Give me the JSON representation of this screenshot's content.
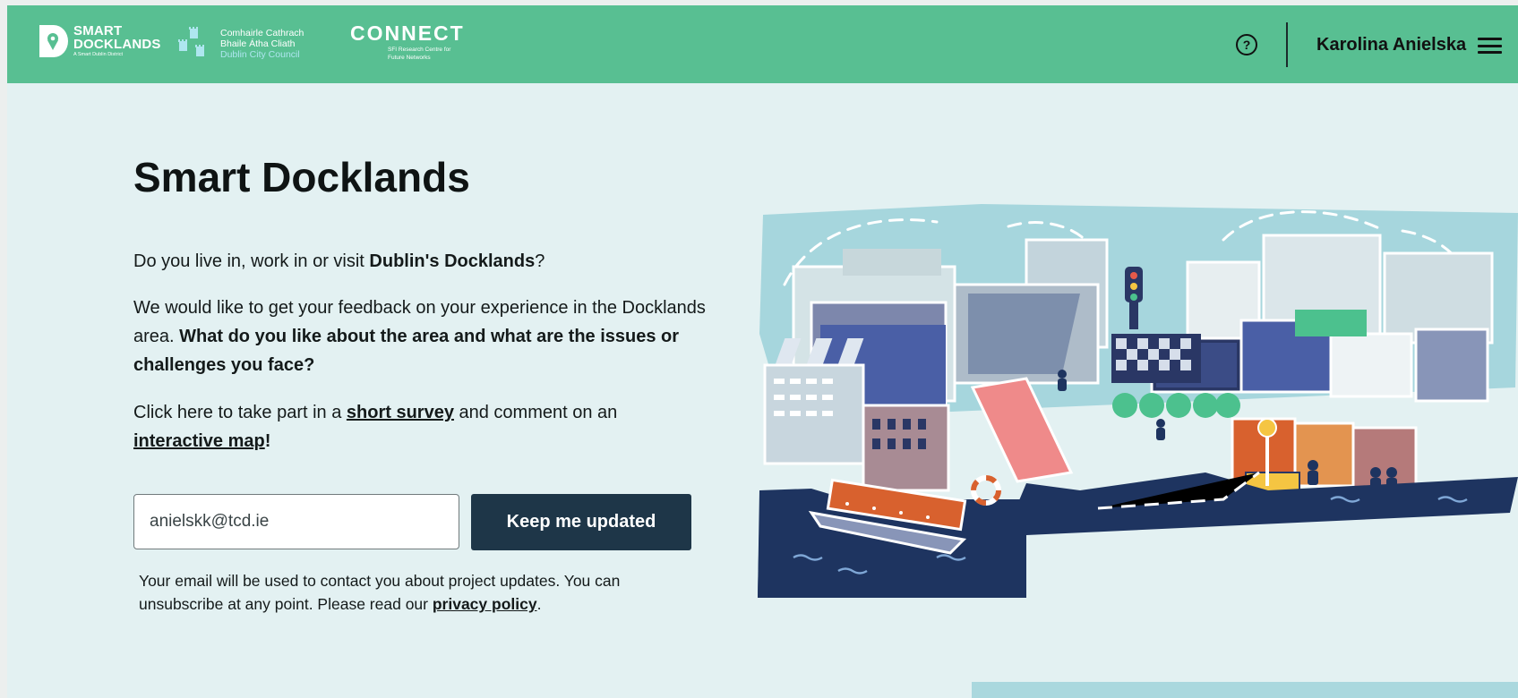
{
  "header": {
    "logo_sd": {
      "line1": "SMART",
      "line2": "DOCKLANDS",
      "tagline": "A Smart Dublin District"
    },
    "logo_dcc": {
      "line1": "Comhairle Cathrach",
      "line2": "Bhaile Átha Cliath",
      "line3": "Dublin City Council"
    },
    "logo_connect": {
      "word": "CONNECT",
      "sub1": "SFI Research Centre for",
      "sub2": "Future Networks"
    },
    "help_icon": "?",
    "user_name": "Karolina Anielska"
  },
  "main": {
    "title": "Smart Docklands",
    "p1": {
      "before": "Do you live in, work in or visit ",
      "bold": "Dublin's Docklands",
      "after": "?"
    },
    "p2": {
      "before": "We would like to get your feedback on your experience in the Docklands area. ",
      "bold": "What do you like about the area and what are the issues or challenges you face?"
    },
    "p3": {
      "before": "Click here to take part in a ",
      "link1": "short survey",
      "middle": " and comment on an ",
      "link2": "interactive map",
      "after": "!"
    },
    "email_value": "anielskk@tcd.ie",
    "keep_button": "Keep me updated",
    "note": {
      "before": "Your email will be used to contact you about project updates. You can unsubscribe at any point. Please read our ",
      "link": "privacy policy",
      "after": "."
    }
  },
  "colors": {
    "header_bg": "#58bf92",
    "page_bg": "#e3f1f2",
    "button_bg": "#1e3648",
    "navy": "#1e3460",
    "sky": "#a6d6dd",
    "orange": "#d8612e",
    "accent_green": "#4cc18e"
  },
  "icons": [
    "help-circle-icon",
    "hamburger-menu-icon"
  ]
}
